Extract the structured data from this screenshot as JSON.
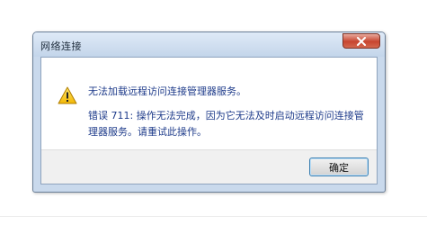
{
  "dialog": {
    "title": "网络连接",
    "message": "无法加载远程访问连接管理器服务。",
    "detail": "错误 711: 操作无法完成，因为它无法及时启动远程访问连接管理器服务。请重试此操作。",
    "ok_label": "确定"
  },
  "icons": {
    "warning": "warning-icon",
    "close": "close-icon"
  },
  "colors": {
    "message_text": "#1e3b8a",
    "close_button": "#c7452f",
    "title_bar": "#c9d9ec"
  }
}
